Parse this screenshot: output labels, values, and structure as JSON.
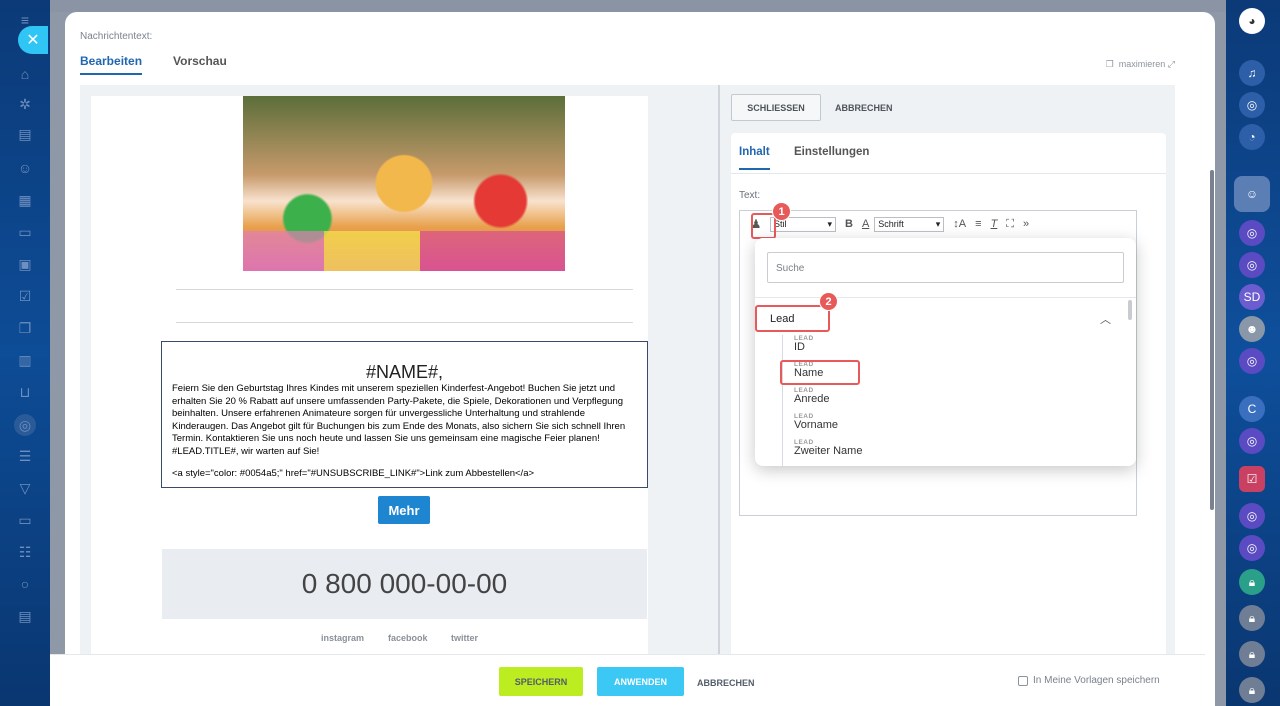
{
  "left_nav": {
    "icons": [
      "menu-icon",
      "home-icon",
      "sparkle-icon",
      "tasks-icon",
      "contacts-icon",
      "documents-icon",
      "card-icon",
      "chat-icon",
      "check-icon",
      "copy-icon",
      "chart-icon",
      "cart-icon",
      "target-icon",
      "database-icon",
      "filter-icon",
      "inbox-icon",
      "group-icon",
      "circle-icon",
      "list-icon"
    ]
  },
  "header": {
    "field_label": "Nachrichtentext:",
    "tab_edit": "Bearbeiten",
    "tab_preview": "Vorschau",
    "maximize": "maximieren"
  },
  "email": {
    "name_placeholder": "#NAME#,",
    "body": "Feiern Sie den Geburtstag Ihres Kindes mit unserem speziellen Kinderfest-Angebot! Buchen Sie jetzt und erhalten Sie 20 % Rabatt auf unsere umfassenden Party-Pakete, die Spiele, Dekorationen und Verpflegung beinhalten. Unsere erfahrenen Animateure sorgen für unvergessliche Unterhaltung und strahlende Kinderaugen. Das Angebot gilt für Buchungen bis zum Ende des Monats, also sichern Sie sich schnell Ihren Termin. Kontaktieren Sie uns noch heute und lassen Sie uns gemeinsam eine magische Feier planen! #LEAD.TITLE#, wir warten auf Sie!",
    "unsubscribe": "<a style=\"color: #0054a5;\" href=\"#UNSUBSCRIBE_LINK#\">Link zum Abbestellen</a>",
    "more_button": "Mehr",
    "phone": "0 800 000-00-00",
    "social": [
      "instagram",
      "facebook",
      "twitter"
    ]
  },
  "settings": {
    "close": "SCHLIESSEN",
    "cancel": "ABBRECHEN",
    "tab_content": "Inhalt",
    "tab_settings": "Einstellungen",
    "text_label": "Text:",
    "toolbar": {
      "style_select": "Stil",
      "font_select": "Schrift"
    }
  },
  "field_picker": {
    "search_placeholder": "Suche",
    "group": "Lead",
    "items": [
      {
        "category": "LEAD",
        "name": "ID"
      },
      {
        "category": "LEAD",
        "name": "Name"
      },
      {
        "category": "LEAD",
        "name": "Anrede"
      },
      {
        "category": "LEAD",
        "name": "Vorname"
      },
      {
        "category": "LEAD",
        "name": "Zweiter Name"
      }
    ]
  },
  "markers": [
    "1",
    "2"
  ],
  "footer": {
    "save": "SPEICHERN",
    "apply": "ANWENDEN",
    "cancel": "ABBRECHEN",
    "save_template": "In Meine Vorlagen speichern"
  },
  "right_nav": {
    "initials": [
      "SD",
      "C"
    ]
  },
  "colors": {
    "accent_blue": "#2067b0",
    "save_green": "#bbed21",
    "apply_cyan": "#3bc8f5",
    "highlight_red": "#e85a5a"
  }
}
